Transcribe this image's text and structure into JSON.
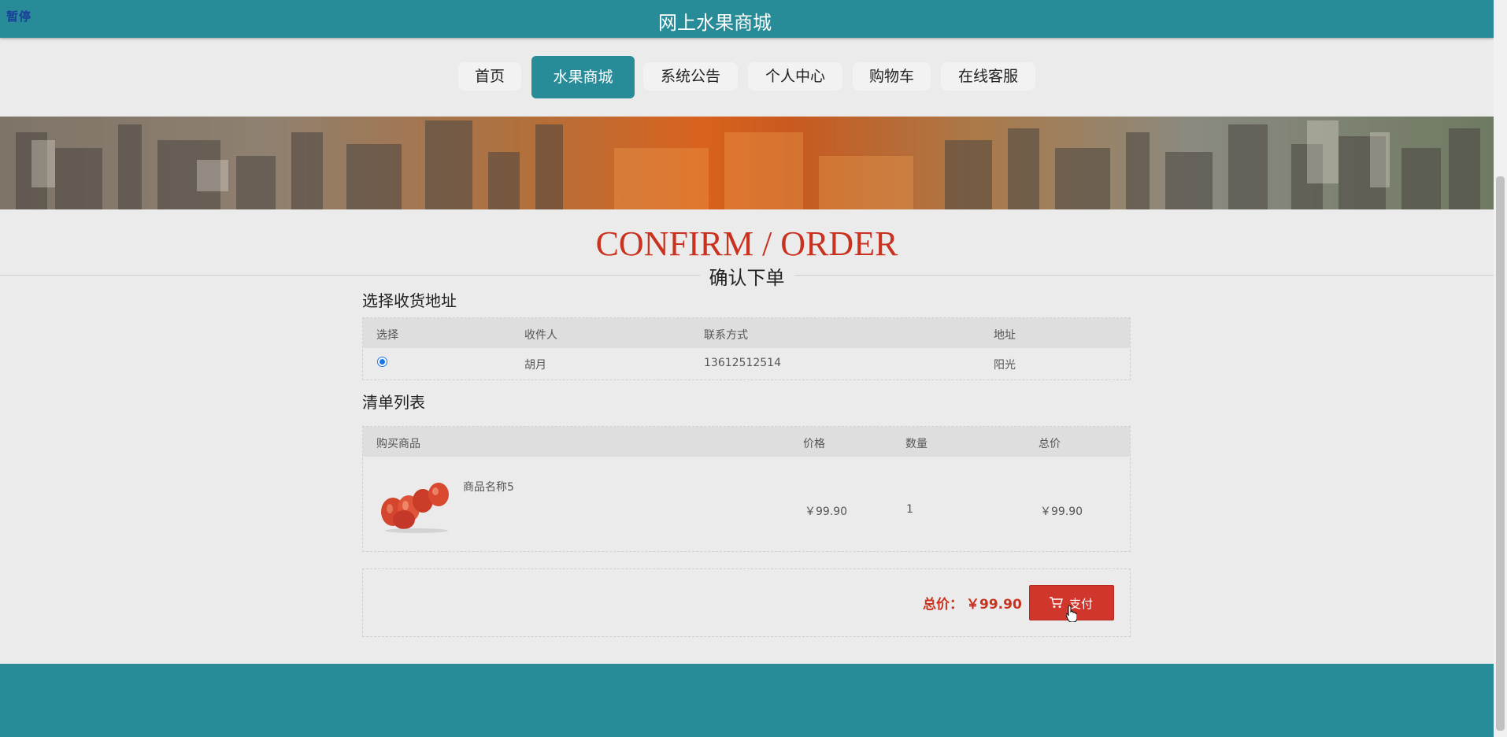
{
  "header": {
    "pause_label": "暂停",
    "site_title": "网上水果商城"
  },
  "nav": {
    "items": [
      {
        "label": "首页"
      },
      {
        "label": "水果商城",
        "active": true
      },
      {
        "label": "系统公告"
      },
      {
        "label": "个人中心"
      },
      {
        "label": "购物车"
      },
      {
        "label": "在线客服"
      }
    ]
  },
  "page": {
    "title_en": "CONFIRM / ORDER",
    "title_cn": "确认下单"
  },
  "address": {
    "section_title": "选择收货地址",
    "headers": {
      "select": "选择",
      "recipient": "收件人",
      "contact": "联系方式",
      "address": "地址"
    },
    "rows": [
      {
        "selected": true,
        "recipient": "胡月",
        "contact": "13612512514",
        "address": "阳光"
      }
    ]
  },
  "order": {
    "section_title": "清单列表",
    "headers": {
      "product": "购买商品",
      "price": "价格",
      "qty": "数量",
      "subtotal": "总价"
    },
    "items": [
      {
        "name": "商品名称5",
        "price": "￥99.90",
        "qty": "1",
        "subtotal": "￥99.90",
        "image_icon": "rose-apple-fruit-image"
      }
    ]
  },
  "summary": {
    "total_label": "总价：",
    "total_value": "￥99.90",
    "pay_label": "支付"
  },
  "colors": {
    "teal": "#278b98",
    "red": "#c9321f",
    "button_red": "#d0362b"
  }
}
